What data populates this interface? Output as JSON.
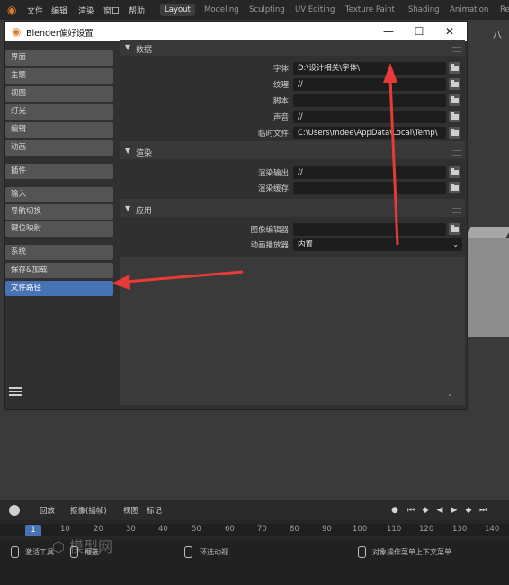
{
  "app_menu": [
    "文件",
    "编辑",
    "渲染",
    "窗口",
    "帮助"
  ],
  "workspaces": [
    "Layout",
    "Modeling",
    "Sculpting",
    "UV Editing",
    "Texture Paint",
    "Shading",
    "Animation",
    "Re"
  ],
  "active_workspace": "Layout",
  "dialog": {
    "title": "Blender偏好设置",
    "minimize": "—",
    "maximize": "☐",
    "close": "✕"
  },
  "sidebar": {
    "items": [
      "界面",
      "主题",
      "视图",
      "灯光",
      "编辑",
      "动画",
      "插件",
      "输入",
      "导航切换",
      "键位映射",
      "系统",
      "保存&加载",
      "文件路径"
    ],
    "active": "文件路径"
  },
  "sections": {
    "data": {
      "label": "数据",
      "rows": [
        {
          "label": "字体",
          "value": "D:\\设计相关\\字体\\"
        },
        {
          "label": "纹理",
          "value": "//"
        },
        {
          "label": "脚本",
          "value": ""
        },
        {
          "label": "声音",
          "value": "//"
        },
        {
          "label": "临时文件",
          "value": "C:\\Users\\mdee\\AppData\\Local\\Temp\\"
        }
      ]
    },
    "render": {
      "label": "渲染",
      "rows": [
        {
          "label": "渲染输出",
          "value": "//"
        },
        {
          "label": "渲染缓存",
          "value": ""
        }
      ]
    },
    "apps": {
      "label": "应用",
      "rows": [
        {
          "label": "图像编辑器",
          "value": ""
        },
        {
          "label": "动画播放器",
          "value": "内置"
        }
      ]
    }
  },
  "timeline": {
    "menu": [
      "回放",
      "抠像(插帧)",
      "视图",
      "标记"
    ],
    "current_frame": "1",
    "ticks": [
      "10",
      "20",
      "30",
      "40",
      "50",
      "60",
      "70",
      "80",
      "90",
      "100",
      "110",
      "120",
      "130",
      "140"
    ]
  },
  "statusbar": {
    "left": "激活工具",
    "mid1": "框选",
    "mid2": "环选动视",
    "right": "对象操作菜单上下文菜单"
  },
  "colors": {
    "accent": "#4772b3",
    "annotation_arrow": "#e83a36",
    "blender_orange": "#e07a2a"
  }
}
